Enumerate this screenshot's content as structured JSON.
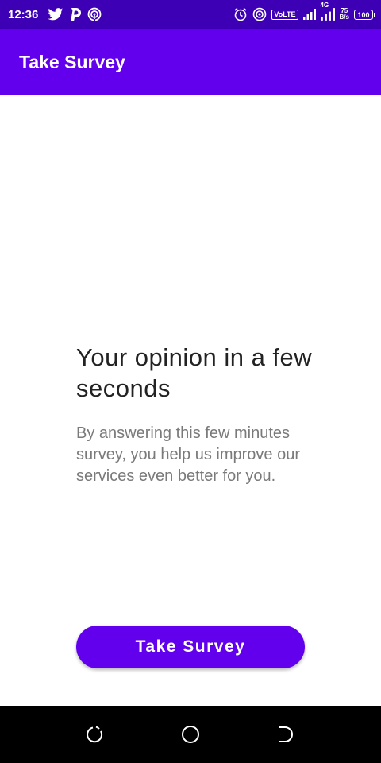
{
  "status_bar": {
    "time": "12:36",
    "network_type": "4G",
    "volte_label": "VoLTE",
    "net_speed_value": "75",
    "net_speed_unit": "B/s",
    "battery_level": "100",
    "icons": [
      "twitter-icon",
      "p-app-icon",
      "hotspot-icon",
      "alarm-icon",
      "hotspot-icon",
      "signal-icon",
      "signal-icon",
      "battery-icon"
    ]
  },
  "app_bar": {
    "title": "Take Survey"
  },
  "content": {
    "heading": "Your opinion in a few seconds",
    "description": "By answering this few minutes survey, you help us improve our services even better for you."
  },
  "cta": {
    "label": "Take Survey"
  },
  "nav_bar": {
    "icons": [
      "recents-icon",
      "home-icon",
      "back-icon"
    ]
  },
  "colors": {
    "status_bar": "#3d00b5",
    "primary": "#6200ee",
    "heading_text": "#222222",
    "description_text": "#7a7a7a",
    "nav_bar": "#000000"
  }
}
